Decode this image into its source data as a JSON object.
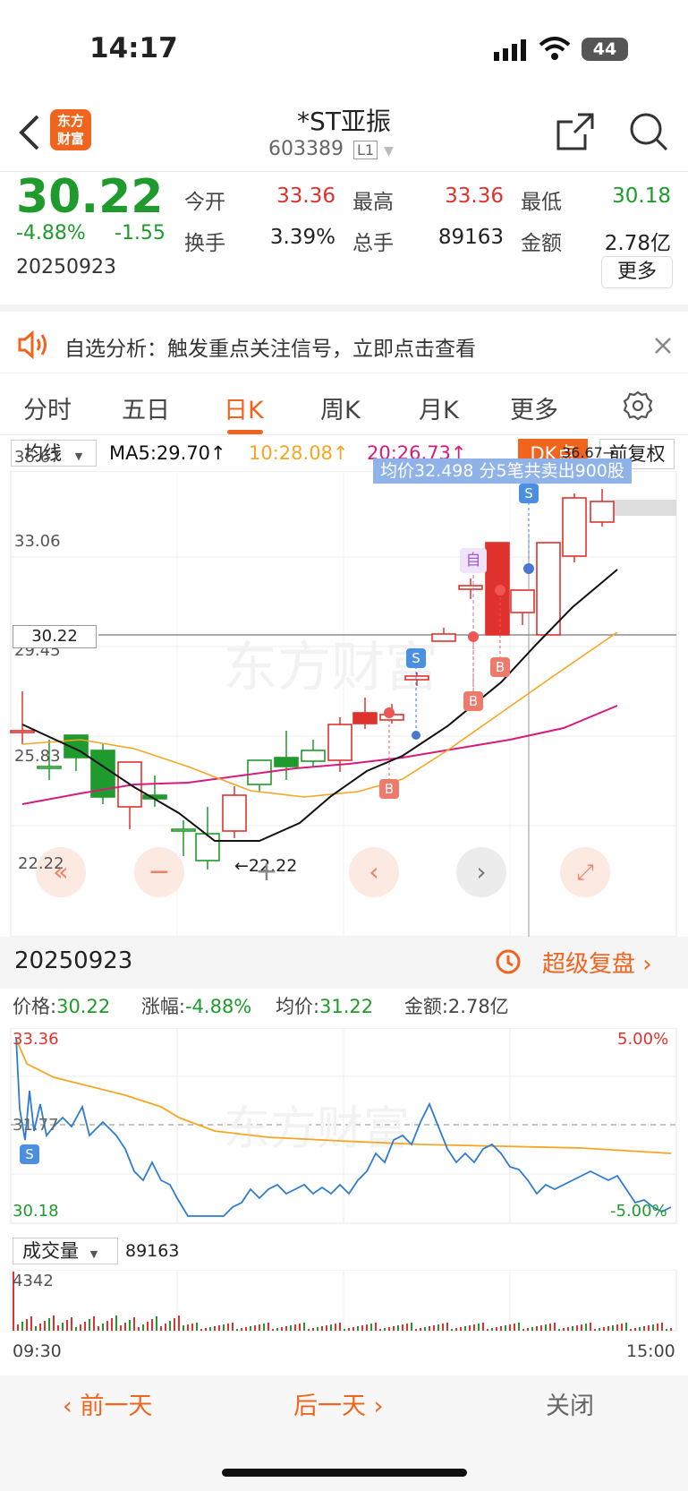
{
  "status_bar": {
    "time": "14:17",
    "battery": "44"
  },
  "header": {
    "name": "*ST亚振",
    "code": "603389",
    "level": "L1",
    "logo_line1": "东方",
    "logo_line2": "财富"
  },
  "quote": {
    "price": "30.22",
    "change_pct": "-4.88%",
    "change": "-1.55",
    "date": "20250923",
    "open_label": "今开",
    "open": "33.36",
    "high_label": "最高",
    "high": "33.36",
    "low_label": "最低",
    "low": "30.18",
    "turnover_label": "换手",
    "turnover": "3.39%",
    "volume_label": "总手",
    "volume": "89163",
    "amount_label": "金额",
    "amount": "2.78亿",
    "more": "更多"
  },
  "banner": {
    "text": "自选分析：触发重点关注信号，立即点击查看"
  },
  "tabs": [
    {
      "label": "分时"
    },
    {
      "label": "五日"
    },
    {
      "label": "日K"
    },
    {
      "label": "周K"
    },
    {
      "label": "月K"
    },
    {
      "label": "更多"
    }
  ],
  "kline": {
    "indicator": "均线",
    "ma5": "MA5:29.70↑",
    "ma10": "10:28.08↑",
    "ma20": "20:26.73↑",
    "dk_button": "DK点",
    "adjust_button": "前复权",
    "tooltip": "均价32.498 分5笔共卖出900股",
    "high_marker": "36.67→",
    "low_marker": "←22.22",
    "current_price_tag": "30.22",
    "y_labels": [
      "36.67",
      "33.06",
      "29.45",
      "25.83",
      "22.22"
    ],
    "signal_s": "S",
    "signal_b": "B",
    "signal_self": "自"
  },
  "day_panel": {
    "date": "20250923",
    "replay": "超级复盘",
    "price_label": "价格:",
    "price": "30.22",
    "pct_label": "涨幅:",
    "pct": "-4.88%",
    "avg_label": "均价:",
    "avg": "31.22",
    "amount_label": "金额:",
    "amount": "2.78亿",
    "y_high": "33.36",
    "y_mid": "31.77",
    "y_low": "30.18",
    "pct_high": "5.00%",
    "pct_low": "-5.00%",
    "volume_selector": "成交量",
    "volume_total": "89163",
    "volume_max": "4342",
    "time_start": "09:30",
    "time_end": "15:00"
  },
  "bottom_bar": {
    "prev": "前一天",
    "next": "后一天",
    "close": "关闭"
  },
  "colors": {
    "up": "#e0322c",
    "down": "#1e9b2c",
    "accent": "#f0641e",
    "ma5": "#111111",
    "ma10": "#f5a623",
    "ma20": "#d81b7a",
    "intraday": "#2f7bd1"
  }
}
